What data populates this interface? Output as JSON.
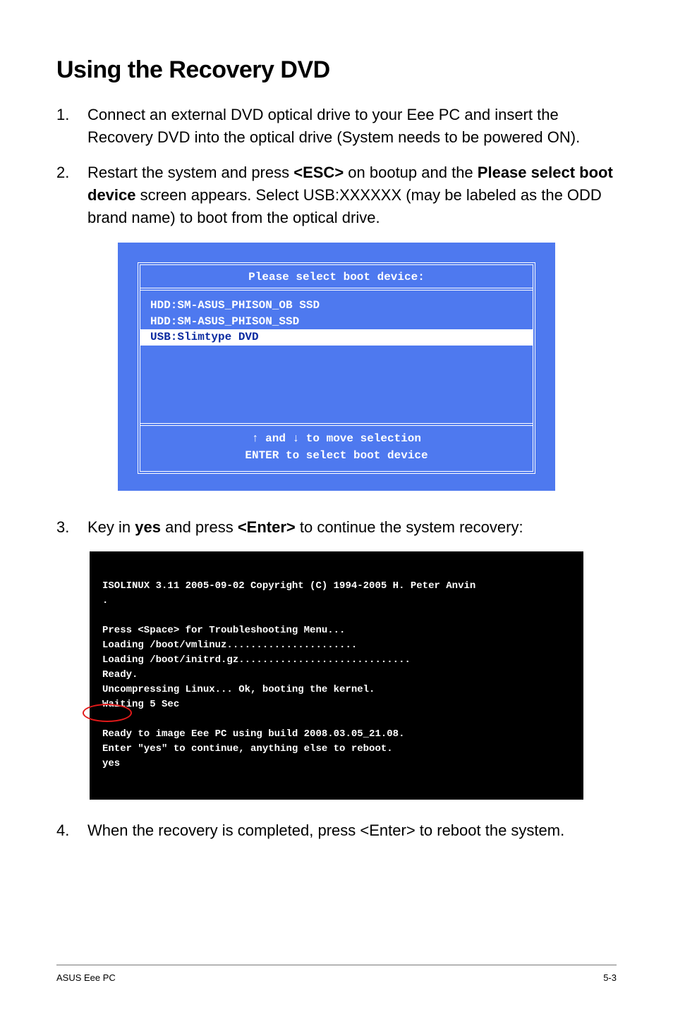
{
  "title": "Using the Recovery DVD",
  "steps": {
    "1": {
      "num": "1.",
      "text": "Connect an external DVD optical drive to your Eee PC and insert the Recovery DVD into the optical drive (System needs to be powered ON)."
    },
    "2": {
      "num": "2.",
      "pre": "Restart the system and press ",
      "key": "<ESC>",
      "mid": " on bootup and the ",
      "label": "Please select boot device",
      "post": " screen appears. Select USB:XXXXXX (may be labeled as the ODD brand name) to boot from the optical drive."
    },
    "3": {
      "num": "3.",
      "pre": "Key in ",
      "yes": "yes",
      "mid": " and press ",
      "key": "<Enter>",
      "post": " to continue the system recovery:"
    },
    "4": {
      "num": "4.",
      "text": "When the recovery is completed, press <Enter> to reboot the system."
    }
  },
  "bootbox": {
    "title": "Please select boot device:",
    "items": [
      "HDD:SM-ASUS_PHISON_OB SSD",
      "HDD:SM-ASUS_PHISON_SSD",
      "USB:Slimtype DVD"
    ],
    "footer1": "↑ and ↓ to move selection",
    "footer2": "ENTER to select boot device"
  },
  "terminal": {
    "line1": "ISOLINUX 3.11 2005-09-02 Copyright (C) 1994-2005 H. Peter Anvin",
    "line2": ".",
    "line3": "Press <Space> for Troubleshooting Menu...",
    "line4": "Loading /boot/vmlinuz......................",
    "line5": "Loading /boot/initrd.gz.............................",
    "line6": "Ready.",
    "line7": "Uncompressing Linux... Ok, booting the kernel.",
    "line8": "Waiting 5 Sec",
    "line9": "Ready to image Eee PC using build 2008.03.05_21.08.",
    "line10": "Enter \"yes\" to continue, anything else to reboot.",
    "line11": "yes"
  },
  "footer": {
    "left": "ASUS Eee PC",
    "right": "5-3"
  }
}
